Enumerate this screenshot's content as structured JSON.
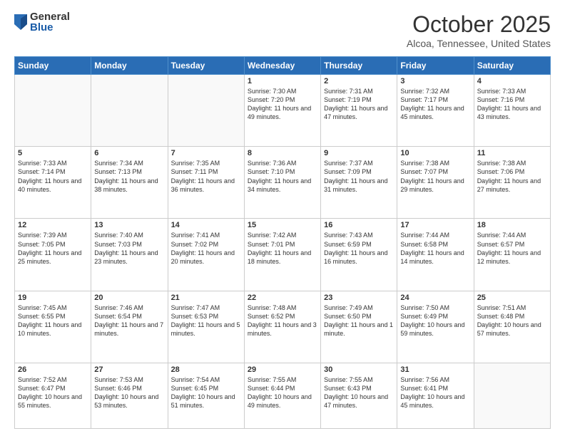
{
  "header": {
    "logo_general": "General",
    "logo_blue": "Blue",
    "month_title": "October 2025",
    "location": "Alcoa, Tennessee, United States"
  },
  "days_of_week": [
    "Sunday",
    "Monday",
    "Tuesday",
    "Wednesday",
    "Thursday",
    "Friday",
    "Saturday"
  ],
  "weeks": [
    [
      {
        "day": "",
        "info": ""
      },
      {
        "day": "",
        "info": ""
      },
      {
        "day": "",
        "info": ""
      },
      {
        "day": "1",
        "info": "Sunrise: 7:30 AM\nSunset: 7:20 PM\nDaylight: 11 hours\nand 49 minutes."
      },
      {
        "day": "2",
        "info": "Sunrise: 7:31 AM\nSunset: 7:19 PM\nDaylight: 11 hours\nand 47 minutes."
      },
      {
        "day": "3",
        "info": "Sunrise: 7:32 AM\nSunset: 7:17 PM\nDaylight: 11 hours\nand 45 minutes."
      },
      {
        "day": "4",
        "info": "Sunrise: 7:33 AM\nSunset: 7:16 PM\nDaylight: 11 hours\nand 43 minutes."
      }
    ],
    [
      {
        "day": "5",
        "info": "Sunrise: 7:33 AM\nSunset: 7:14 PM\nDaylight: 11 hours\nand 40 minutes."
      },
      {
        "day": "6",
        "info": "Sunrise: 7:34 AM\nSunset: 7:13 PM\nDaylight: 11 hours\nand 38 minutes."
      },
      {
        "day": "7",
        "info": "Sunrise: 7:35 AM\nSunset: 7:11 PM\nDaylight: 11 hours\nand 36 minutes."
      },
      {
        "day": "8",
        "info": "Sunrise: 7:36 AM\nSunset: 7:10 PM\nDaylight: 11 hours\nand 34 minutes."
      },
      {
        "day": "9",
        "info": "Sunrise: 7:37 AM\nSunset: 7:09 PM\nDaylight: 11 hours\nand 31 minutes."
      },
      {
        "day": "10",
        "info": "Sunrise: 7:38 AM\nSunset: 7:07 PM\nDaylight: 11 hours\nand 29 minutes."
      },
      {
        "day": "11",
        "info": "Sunrise: 7:38 AM\nSunset: 7:06 PM\nDaylight: 11 hours\nand 27 minutes."
      }
    ],
    [
      {
        "day": "12",
        "info": "Sunrise: 7:39 AM\nSunset: 7:05 PM\nDaylight: 11 hours\nand 25 minutes."
      },
      {
        "day": "13",
        "info": "Sunrise: 7:40 AM\nSunset: 7:03 PM\nDaylight: 11 hours\nand 23 minutes."
      },
      {
        "day": "14",
        "info": "Sunrise: 7:41 AM\nSunset: 7:02 PM\nDaylight: 11 hours\nand 20 minutes."
      },
      {
        "day": "15",
        "info": "Sunrise: 7:42 AM\nSunset: 7:01 PM\nDaylight: 11 hours\nand 18 minutes."
      },
      {
        "day": "16",
        "info": "Sunrise: 7:43 AM\nSunset: 6:59 PM\nDaylight: 11 hours\nand 16 minutes."
      },
      {
        "day": "17",
        "info": "Sunrise: 7:44 AM\nSunset: 6:58 PM\nDaylight: 11 hours\nand 14 minutes."
      },
      {
        "day": "18",
        "info": "Sunrise: 7:44 AM\nSunset: 6:57 PM\nDaylight: 11 hours\nand 12 minutes."
      }
    ],
    [
      {
        "day": "19",
        "info": "Sunrise: 7:45 AM\nSunset: 6:55 PM\nDaylight: 11 hours\nand 10 minutes."
      },
      {
        "day": "20",
        "info": "Sunrise: 7:46 AM\nSunset: 6:54 PM\nDaylight: 11 hours\nand 7 minutes."
      },
      {
        "day": "21",
        "info": "Sunrise: 7:47 AM\nSunset: 6:53 PM\nDaylight: 11 hours\nand 5 minutes."
      },
      {
        "day": "22",
        "info": "Sunrise: 7:48 AM\nSunset: 6:52 PM\nDaylight: 11 hours\nand 3 minutes."
      },
      {
        "day": "23",
        "info": "Sunrise: 7:49 AM\nSunset: 6:50 PM\nDaylight: 11 hours\nand 1 minute."
      },
      {
        "day": "24",
        "info": "Sunrise: 7:50 AM\nSunset: 6:49 PM\nDaylight: 10 hours\nand 59 minutes."
      },
      {
        "day": "25",
        "info": "Sunrise: 7:51 AM\nSunset: 6:48 PM\nDaylight: 10 hours\nand 57 minutes."
      }
    ],
    [
      {
        "day": "26",
        "info": "Sunrise: 7:52 AM\nSunset: 6:47 PM\nDaylight: 10 hours\nand 55 minutes."
      },
      {
        "day": "27",
        "info": "Sunrise: 7:53 AM\nSunset: 6:46 PM\nDaylight: 10 hours\nand 53 minutes."
      },
      {
        "day": "28",
        "info": "Sunrise: 7:54 AM\nSunset: 6:45 PM\nDaylight: 10 hours\nand 51 minutes."
      },
      {
        "day": "29",
        "info": "Sunrise: 7:55 AM\nSunset: 6:44 PM\nDaylight: 10 hours\nand 49 minutes."
      },
      {
        "day": "30",
        "info": "Sunrise: 7:55 AM\nSunset: 6:43 PM\nDaylight: 10 hours\nand 47 minutes."
      },
      {
        "day": "31",
        "info": "Sunrise: 7:56 AM\nSunset: 6:41 PM\nDaylight: 10 hours\nand 45 minutes."
      },
      {
        "day": "",
        "info": ""
      }
    ]
  ]
}
